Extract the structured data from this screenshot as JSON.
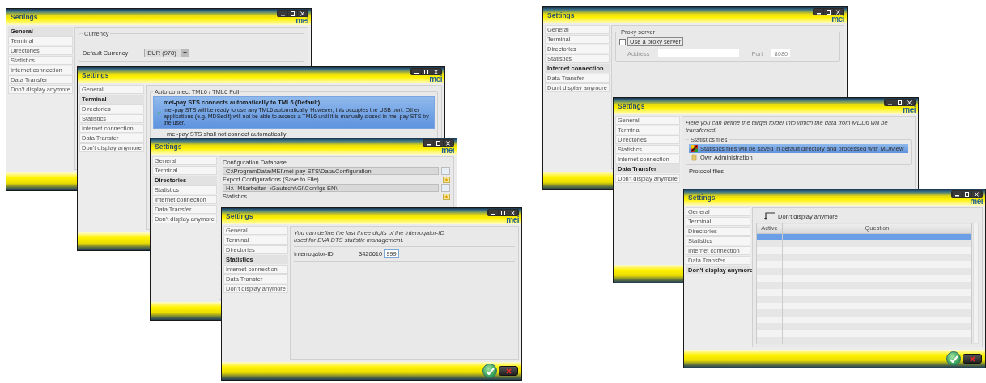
{
  "windows": [
    {
      "title": "Settings",
      "logo": "mei",
      "sidebar": [
        {
          "label": "General",
          "selected": true
        },
        {
          "label": "Terminal",
          "selected": false
        },
        {
          "label": "Directories",
          "selected": false
        },
        {
          "label": "Statistics",
          "selected": false
        },
        {
          "label": "Internet connection",
          "selected": false
        },
        {
          "label": "Data Transfer",
          "selected": false
        },
        {
          "label": "Don't display anymore",
          "selected": false
        }
      ],
      "content": {
        "kind": "currency",
        "group": "Currency",
        "label": "Default Currency",
        "value": "EUR (978)"
      }
    },
    {
      "title": "Settings",
      "logo": "mei",
      "sidebar": [
        {
          "label": "General",
          "selected": false
        },
        {
          "label": "Terminal",
          "selected": true
        },
        {
          "label": "Directories",
          "selected": false
        },
        {
          "label": "Statistics",
          "selected": false
        },
        {
          "label": "Internet connection",
          "selected": false
        },
        {
          "label": "Data Transfer",
          "selected": false
        },
        {
          "label": "Don't display anymore",
          "selected": false
        }
      ],
      "content": {
        "kind": "autoconnect",
        "group": "Auto connect TML6 / TML6 Full",
        "options": [
          {
            "title": "mei-pay STS connects automatically to TML6 (Default)",
            "description": "mei-pay STS will be ready to use any TML6 automatically. However, this occupies the USB port. Other applications (e.g. MDSedit) will not be able to access a TML6 until it is manually closed in mei-pay STS by the user.",
            "selected": true
          },
          {
            "title": "mei-pay STS shall not connect automatically",
            "selected": false
          }
        ]
      }
    },
    {
      "title": "Settings",
      "logo": "mei",
      "sidebar": [
        {
          "label": "General",
          "selected": false
        },
        {
          "label": "Terminal",
          "selected": false
        },
        {
          "label": "Directories",
          "selected": true
        },
        {
          "label": "Statistics",
          "selected": false
        },
        {
          "label": "Internet connection",
          "selected": false
        },
        {
          "label": "Data Transfer",
          "selected": false
        },
        {
          "label": "Don't display anymore",
          "selected": false
        }
      ],
      "content": {
        "kind": "directories",
        "entries": [
          {
            "label": "Configuration Database",
            "value": "C:\\ProgramData\\MEI\\mei-pay STS\\Data\\Configuration",
            "browse": "...",
            "starred": false
          },
          {
            "label": "Export Configurations (Save to File)",
            "value": "H:\\- Mitarbeiter -\\Gautschi\\Gi\\Configs EN\\",
            "browse": "...",
            "starred": true
          },
          {
            "label": "Statistics",
            "starred": true
          }
        ]
      }
    },
    {
      "title": "Settings",
      "logo": "mei",
      "sidebar": [
        {
          "label": "General",
          "selected": false
        },
        {
          "label": "Terminal",
          "selected": false
        },
        {
          "label": "Directories",
          "selected": false
        },
        {
          "label": "Statistics",
          "selected": true
        },
        {
          "label": "Internet connection",
          "selected": false
        },
        {
          "label": "Data Transfer",
          "selected": false
        },
        {
          "label": "Don't display anymore",
          "selected": false
        }
      ],
      "content": {
        "kind": "interrogator",
        "description": "You can define the last three digits of the interrogator-ID used for EVA DTS statistic management.",
        "label": "Interrogator-ID",
        "prefix": "3420610",
        "value": "999"
      },
      "dialog_buttons": [
        {
          "kind": "ok"
        },
        {
          "kind": "cancel"
        }
      ]
    },
    {
      "title": "Settings",
      "logo": "mei",
      "sidebar": [
        {
          "label": "General",
          "selected": false
        },
        {
          "label": "Terminal",
          "selected": false
        },
        {
          "label": "Directories",
          "selected": false
        },
        {
          "label": "Statistics",
          "selected": false
        },
        {
          "label": "Internet connection",
          "selected": true
        },
        {
          "label": "Data Transfer",
          "selected": false
        },
        {
          "label": "Don't display anymore",
          "selected": false
        }
      ],
      "content": {
        "kind": "proxy",
        "group": "Proxy server",
        "checkbox": {
          "label": "Use a proxy server",
          "checked": false
        },
        "address": {
          "label": "Address",
          "disabled": true
        },
        "port": {
          "label": "Port",
          "value": "8080",
          "disabled": true
        }
      }
    },
    {
      "title": "Settings",
      "logo": "mei",
      "sidebar": [
        {
          "label": "General",
          "selected": false
        },
        {
          "label": "Terminal",
          "selected": false
        },
        {
          "label": "Directories",
          "selected": false
        },
        {
          "label": "Statistics",
          "selected": false
        },
        {
          "label": "Internet connection",
          "selected": false
        },
        {
          "label": "Data Transfer",
          "selected": true
        },
        {
          "label": "Don't display anymore",
          "selected": false
        }
      ],
      "content": {
        "kind": "transfer",
        "description": "Here you can define the target folder into which the data from MDD6 will be transferred.",
        "group": "Statistics files",
        "options": [
          {
            "kind": "program",
            "label": "Statistics files will be saved in default directory and processed with MDIview",
            "selected": true
          },
          {
            "kind": "folder",
            "label": "Own Administration",
            "selected": false
          }
        ],
        "next_group": "Protocol files"
      }
    },
    {
      "title": "Settings",
      "logo": "mei",
      "sidebar": [
        {
          "label": "General",
          "selected": false
        },
        {
          "label": "Terminal",
          "selected": false
        },
        {
          "label": "Directories",
          "selected": false
        },
        {
          "label": "Statistics",
          "selected": false
        },
        {
          "label": "Internet connection",
          "selected": false
        },
        {
          "label": "Data Transfer",
          "selected": false
        },
        {
          "label": "Don't display anymore",
          "selected": true
        }
      ],
      "content": {
        "kind": "table",
        "caption": "Don't display anymore",
        "columns": [
          "Active",
          "Question"
        ],
        "rows": [
          {
            "selected": true
          },
          {
            "selected": false
          },
          {
            "selected": false
          },
          {
            "selected": false
          },
          {
            "selected": false
          },
          {
            "selected": false
          },
          {
            "selected": false
          },
          {
            "selected": false
          },
          {
            "selected": false
          },
          {
            "selected": false
          },
          {
            "selected": false
          },
          {
            "selected": false
          },
          {
            "selected": false
          },
          {
            "selected": false
          },
          {
            "selected": false
          },
          {
            "selected": false
          }
        ]
      },
      "dialog_buttons": [
        {
          "kind": "ok"
        },
        {
          "kind": "cancel"
        }
      ]
    }
  ]
}
